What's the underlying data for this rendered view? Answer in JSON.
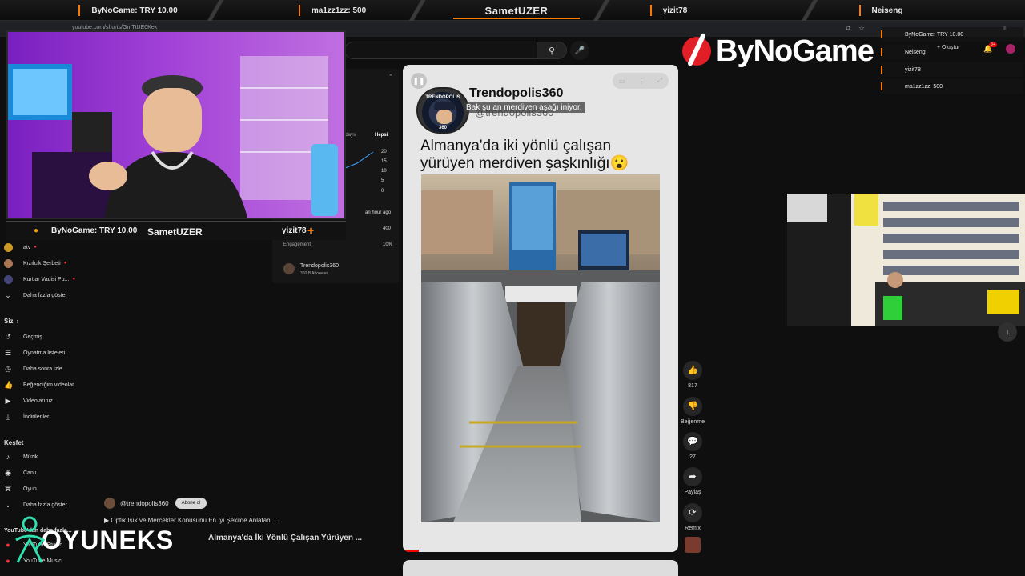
{
  "ticker": {
    "streamer": "SametUZER",
    "items": [
      "ByNoGame: TRY 10.00",
      "ma1zz1zz: 500",
      "yizit78",
      "Neiseng"
    ]
  },
  "browser": {
    "url": "youtube.com/shorts/GmTtUE0Kek"
  },
  "studio_panel": {
    "last28": "Last 28 days",
    "hepsi": "Hepsi",
    "ticks": [
      "20",
      "15",
      "10",
      "5",
      "0"
    ],
    "ago": "an hour ago",
    "stat1": "400",
    "engagement_label": "Engagement",
    "stat2": "10%",
    "channel": "Trendopolis360",
    "subs": "360 B Aboneler"
  },
  "sidebar": {
    "items_top": [
      {
        "label": "atv"
      },
      {
        "label": "Kızılcık Şerbeti"
      },
      {
        "label": "Kurtlar Vadisi Pu..."
      }
    ],
    "more1": "Daha fazla göster",
    "siz": "Siz",
    "you_items": [
      "Geçmiş",
      "Oynatma listeleri",
      "Daha sonra izle",
      "Beğendiğim videolar",
      "Videolarınız",
      "İndirilenler"
    ],
    "kesfet": "Keşfet",
    "explore_items": [
      "Müzik",
      "Canlı",
      "Oyun"
    ],
    "more2": "Daha fazla göster",
    "more_from": "YouTube'dan daha fazla...",
    "studio": "YouTube Studio",
    "music": "YouTube Music"
  },
  "short": {
    "handle": "Trendopolis360",
    "at_handle": "@trendopolis360",
    "avatar_top": "TRENDOPOLIS",
    "avatar_bottom": "360",
    "subtitle": "Bak şu an merdiven aşağı iniyor.",
    "title": "Almanya'da iki yönlü çalışan yürüyen merdiven şaşkınlığı😮"
  },
  "actions": {
    "like_count": "817",
    "dislike": "Beğenme",
    "comments": "27",
    "share": "Paylaş",
    "remix": "Remix"
  },
  "below": {
    "owner": "@trendopolis360",
    "subscribe": "Abone ol",
    "next1": "Optik Işık ve Mercekler Konusunu En İyi Şekilde Anlatan ...",
    "next2": "Almanya'da İki Yönlü Çalışan Yürüyen ..."
  },
  "header": {
    "create": "Oluştur",
    "notif_count": "9+"
  },
  "cam_info": {
    "donation": "ByNoGame: TRY 10.00",
    "streamer": "SametUZER",
    "last": "yizit78"
  },
  "right_donations": [
    "ByNoGame: TRY 10.00",
    "Neiseng",
    "yizit78",
    "ma1zz1zz: 500"
  ],
  "branding": {
    "bynogame": "ByNoGame",
    "oyuneks": "OYUNEKS"
  },
  "colors": {
    "accent": "#ff7a00",
    "bynogame_red": "#e21f26",
    "yt_bg": "#0f0f0f"
  }
}
